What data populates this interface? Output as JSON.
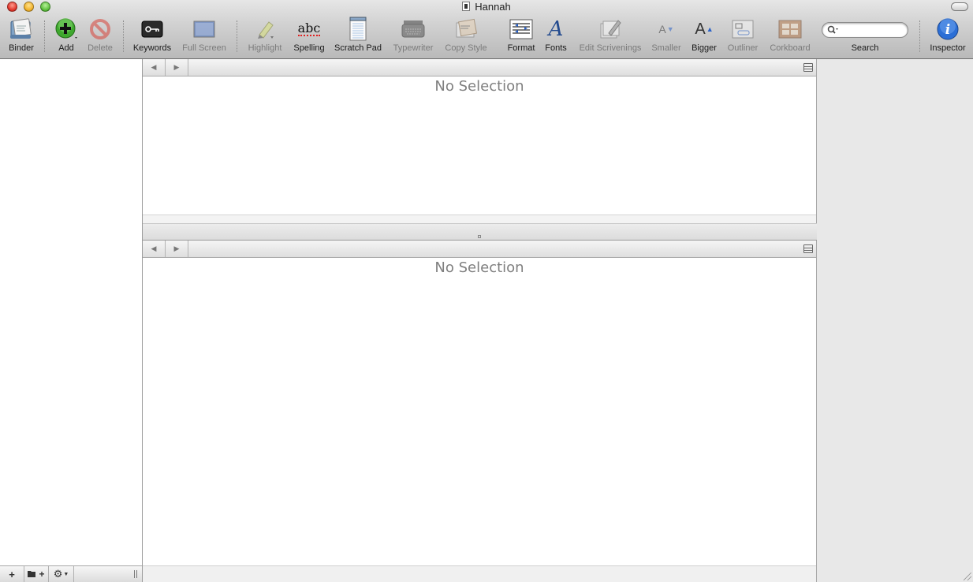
{
  "window": {
    "title": "Hannah"
  },
  "toolbar": {
    "binder": "Binder",
    "add": "Add",
    "delete": "Delete",
    "keywords": "Keywords",
    "full_screen": "Full Screen",
    "highlight": "Highlight",
    "spelling": "Spelling",
    "spelling_icon_text": "abc",
    "scratch_pad": "Scratch Pad",
    "typewriter": "Typewriter",
    "copy_style": "Copy Style",
    "format": "Format",
    "fonts": "Fonts",
    "edit_scrivenings": "Edit Scrivenings",
    "smaller": "Smaller",
    "bigger": "Bigger",
    "outliner": "Outliner",
    "corkboard": "Corkboard",
    "search": "Search",
    "search_placeholder": "",
    "inspector": "Inspector",
    "fonts_icon_text": "A",
    "smaller_icon_text": "A",
    "bigger_icon_text": "A",
    "inspector_icon_text": "i"
  },
  "editors": {
    "top": {
      "empty_text": "No Selection"
    },
    "bottom": {
      "empty_text": "No Selection"
    }
  },
  "binder_footer": {
    "add_symbol": "+",
    "folder_add_symbol": "+",
    "gear_symbol": "⚙"
  },
  "colors": {
    "add_green": "#3fa82e",
    "delete_red": "#d8443a",
    "inspector_blue": "#2c6fd6"
  }
}
